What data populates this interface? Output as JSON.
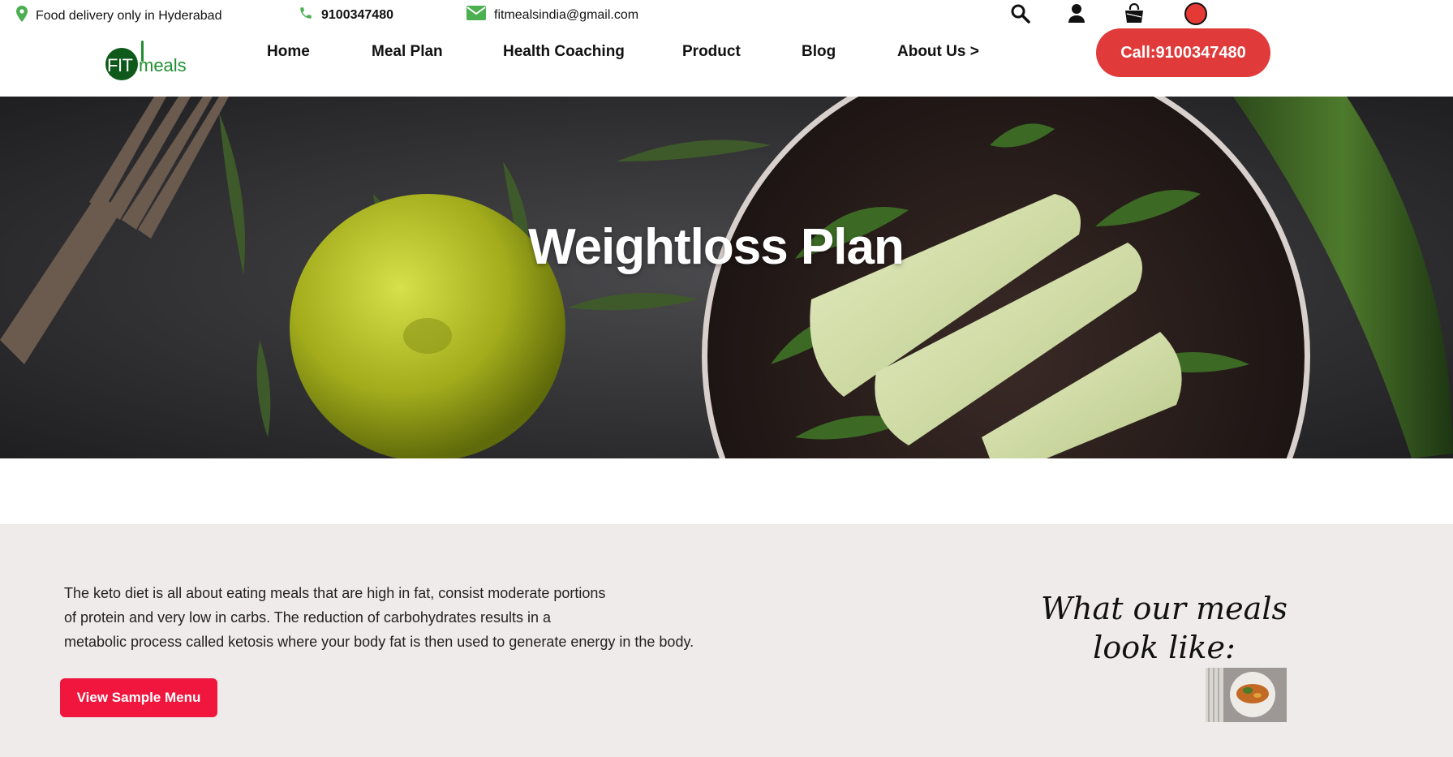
{
  "topbar": {
    "location_text": "Food delivery only in Hyderabad",
    "phone": "9100347480",
    "email": "fitmealsindia@gmail.com",
    "icons": [
      "location-pin-icon",
      "phone-icon",
      "envelope-icon",
      "search-icon",
      "user-icon",
      "shopping-bag-icon",
      "record-dot-icon"
    ]
  },
  "logo": {
    "part1": "FIT",
    "part2": "meals"
  },
  "nav": {
    "items": [
      "Home",
      "Meal Plan",
      "Health Coaching",
      "Product",
      "Blog",
      "About Us >"
    ],
    "cta_label": "Call:9100347480"
  },
  "hero": {
    "title": "Weightloss Plan"
  },
  "content": {
    "description_lines": [
      "The keto diet is all about eating meals that are high in fat, consist moderate portions",
      "of protein and very low in carbs. The reduction of carbohydrates results in a",
      "metabolic process called ketosis where your body fat is then used to generate energy in the body."
    ],
    "button_label": "View Sample Menu",
    "meals_heading": "What our meals look like:"
  },
  "colors": {
    "accent_green": "#4caf50",
    "cta_red": "#e03a3a",
    "button_red": "#f0163d",
    "content_bg": "#efebea"
  }
}
